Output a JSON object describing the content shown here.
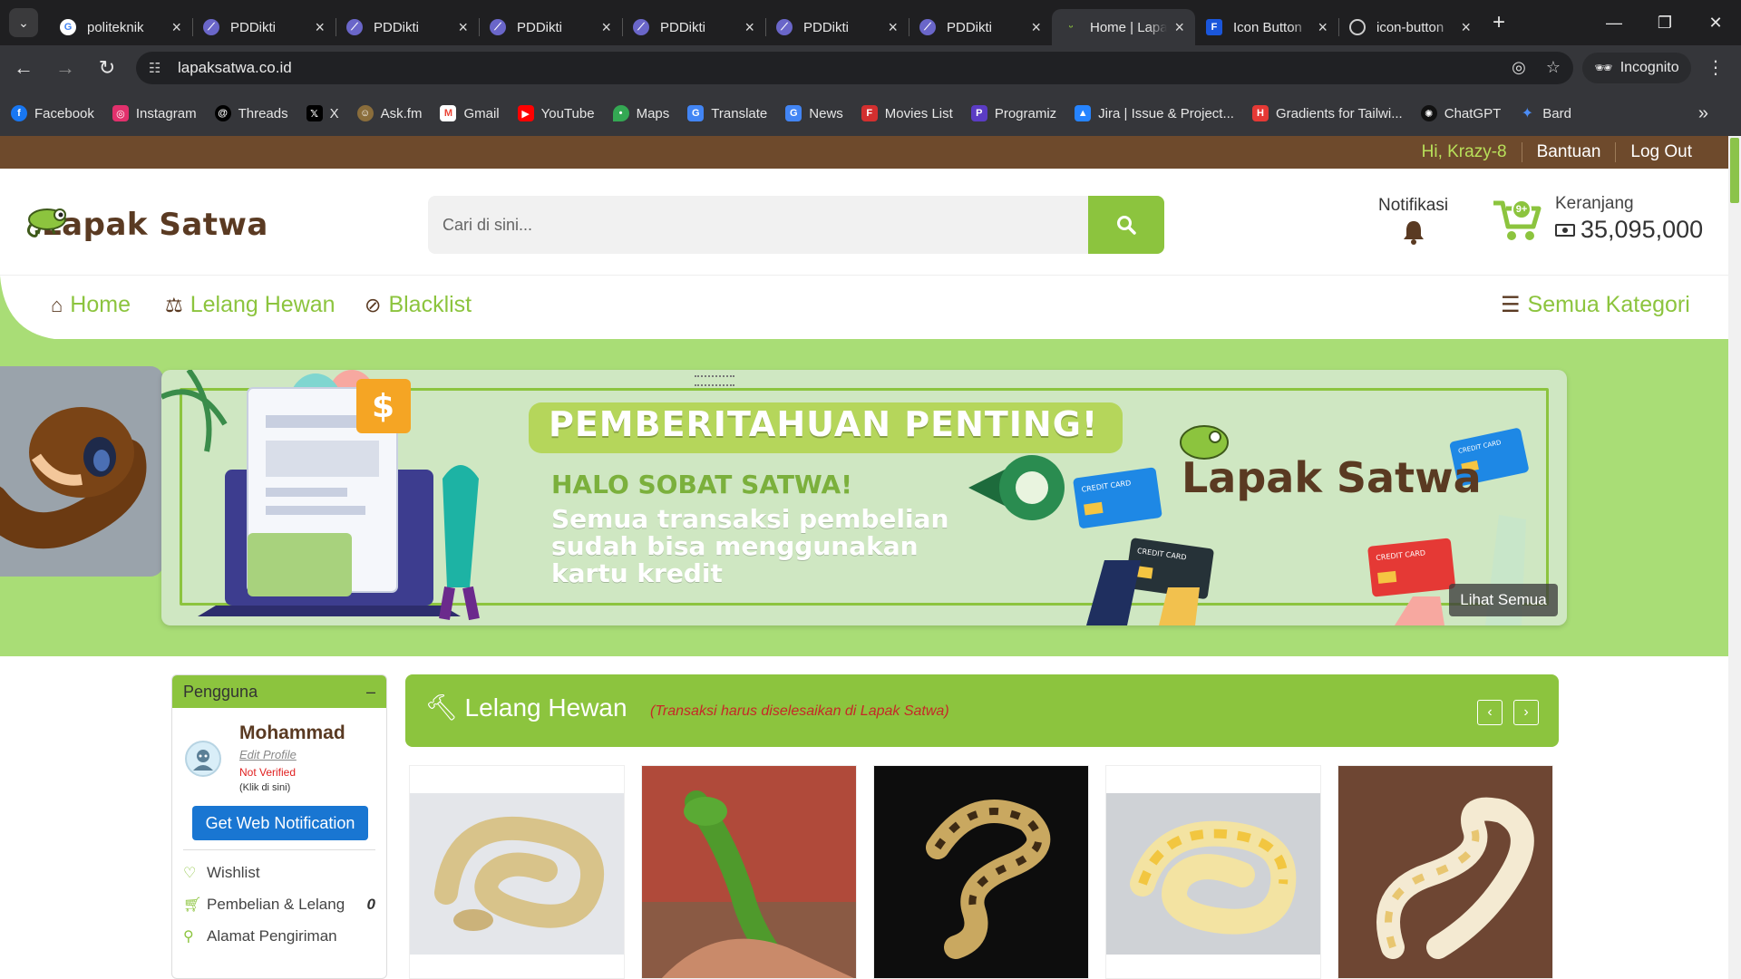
{
  "browser": {
    "tabs": [
      {
        "title": "politeknik",
        "favicon": "google-icon",
        "active": false
      },
      {
        "title": "PDDikti",
        "favicon": "pddikti-icon",
        "active": false
      },
      {
        "title": "PDDikti",
        "favicon": "pddikti-icon",
        "active": false
      },
      {
        "title": "PDDikti",
        "favicon": "pddikti-icon",
        "active": false
      },
      {
        "title": "PDDikti",
        "favicon": "pddikti-icon",
        "active": false
      },
      {
        "title": "PDDikti",
        "favicon": "pddikti-icon",
        "active": false
      },
      {
        "title": "PDDikti",
        "favicon": "pddikti-icon",
        "active": false
      },
      {
        "title": "Home | Lapak Satwa",
        "favicon": "lapaksatwa-icon",
        "active": true
      },
      {
        "title": "Icon Button",
        "favicon": "flowbite-icon",
        "active": false
      },
      {
        "title": "icon-button",
        "favicon": "globe-icon",
        "active": false
      }
    ],
    "url": "lapaksatwa.co.id",
    "incognito_label": "Incognito",
    "bookmarks": [
      {
        "label": "Facebook",
        "icon": "facebook-icon",
        "color": "#1877f2"
      },
      {
        "label": "Instagram",
        "icon": "instagram-icon",
        "color": "#e1306c"
      },
      {
        "label": "Threads",
        "icon": "threads-icon",
        "color": "#000000"
      },
      {
        "label": "X",
        "icon": "x-icon",
        "color": "#000000"
      },
      {
        "label": "Ask.fm",
        "icon": "askfm-icon",
        "color": "#8a6d3b"
      },
      {
        "label": "Gmail",
        "icon": "gmail-icon",
        "color": "#ea4335"
      },
      {
        "label": "YouTube",
        "icon": "youtube-icon",
        "color": "#ff0000"
      },
      {
        "label": "Maps",
        "icon": "maps-icon",
        "color": "#34a853"
      },
      {
        "label": "Translate",
        "icon": "translate-icon",
        "color": "#4285f4"
      },
      {
        "label": "News",
        "icon": "news-icon",
        "color": "#4285f4"
      },
      {
        "label": "Movies List",
        "icon": "movies-icon",
        "color": "#d32f2f"
      },
      {
        "label": "Programiz",
        "icon": "programiz-icon",
        "color": "#5b3cc4"
      },
      {
        "label": "Jira | Issue & Project...",
        "icon": "jira-icon",
        "color": "#2684ff"
      },
      {
        "label": "Gradients for Tailwi...",
        "icon": "gradients-icon",
        "color": "#e53935"
      },
      {
        "label": "ChatGPT",
        "icon": "chatgpt-icon",
        "color": "#111111"
      },
      {
        "label": "Bard",
        "icon": "bard-icon",
        "color": "#4c8df6"
      }
    ]
  },
  "topbar": {
    "greeting": "Hi, Krazy-8",
    "help": "Bantuan",
    "logout": "Log Out"
  },
  "header": {
    "logo_text": "Lapak Satwa",
    "search_placeholder": "Cari di sini...",
    "notif_label": "Notifikasi",
    "cart_label": "Keranjang",
    "cart_badge": "9+",
    "cart_amount": "35,095,000"
  },
  "nav": {
    "home": "Home",
    "lelang": "Lelang Hewan",
    "blacklist": "Blacklist",
    "kategori": "Semua Kategori"
  },
  "banner": {
    "headline": "PEMBERITAHUAN PENTING!",
    "sub1": "HALO SOBAT SATWA!",
    "sub2": "Semua transaksi pembelian sudah bisa menggunakan kartu kredit",
    "brand": "Lapak Satwa",
    "card_label": "CREDIT CARD",
    "see_all": "Lihat Semua"
  },
  "user_card": {
    "header": "Pengguna",
    "collapse": "–",
    "name": "Mohammad",
    "edit_profile": "Edit Profile",
    "status": "Not Verified",
    "status_hint": "(Klik di sini)",
    "notif_button": "Get Web Notification",
    "menu": [
      {
        "label": "Wishlist",
        "icon": "heart-icon",
        "count": ""
      },
      {
        "label": "Pembelian & Lelang",
        "icon": "cart-icon",
        "count": "0"
      },
      {
        "label": "Alamat Pengiriman",
        "icon": "map-marker-icon",
        "count": ""
      }
    ]
  },
  "lelang": {
    "title": "Lelang Hewan",
    "note": "(Transaksi harus diselesaikan di Lapak Satwa)",
    "prev": "‹",
    "next": "›"
  },
  "colors": {
    "brand_green": "#8cc43e",
    "brand_brown": "#6e4a2c",
    "banner_bg": "#a9dd76",
    "notif_red": "#e02020",
    "button_blue": "#1976d2"
  }
}
